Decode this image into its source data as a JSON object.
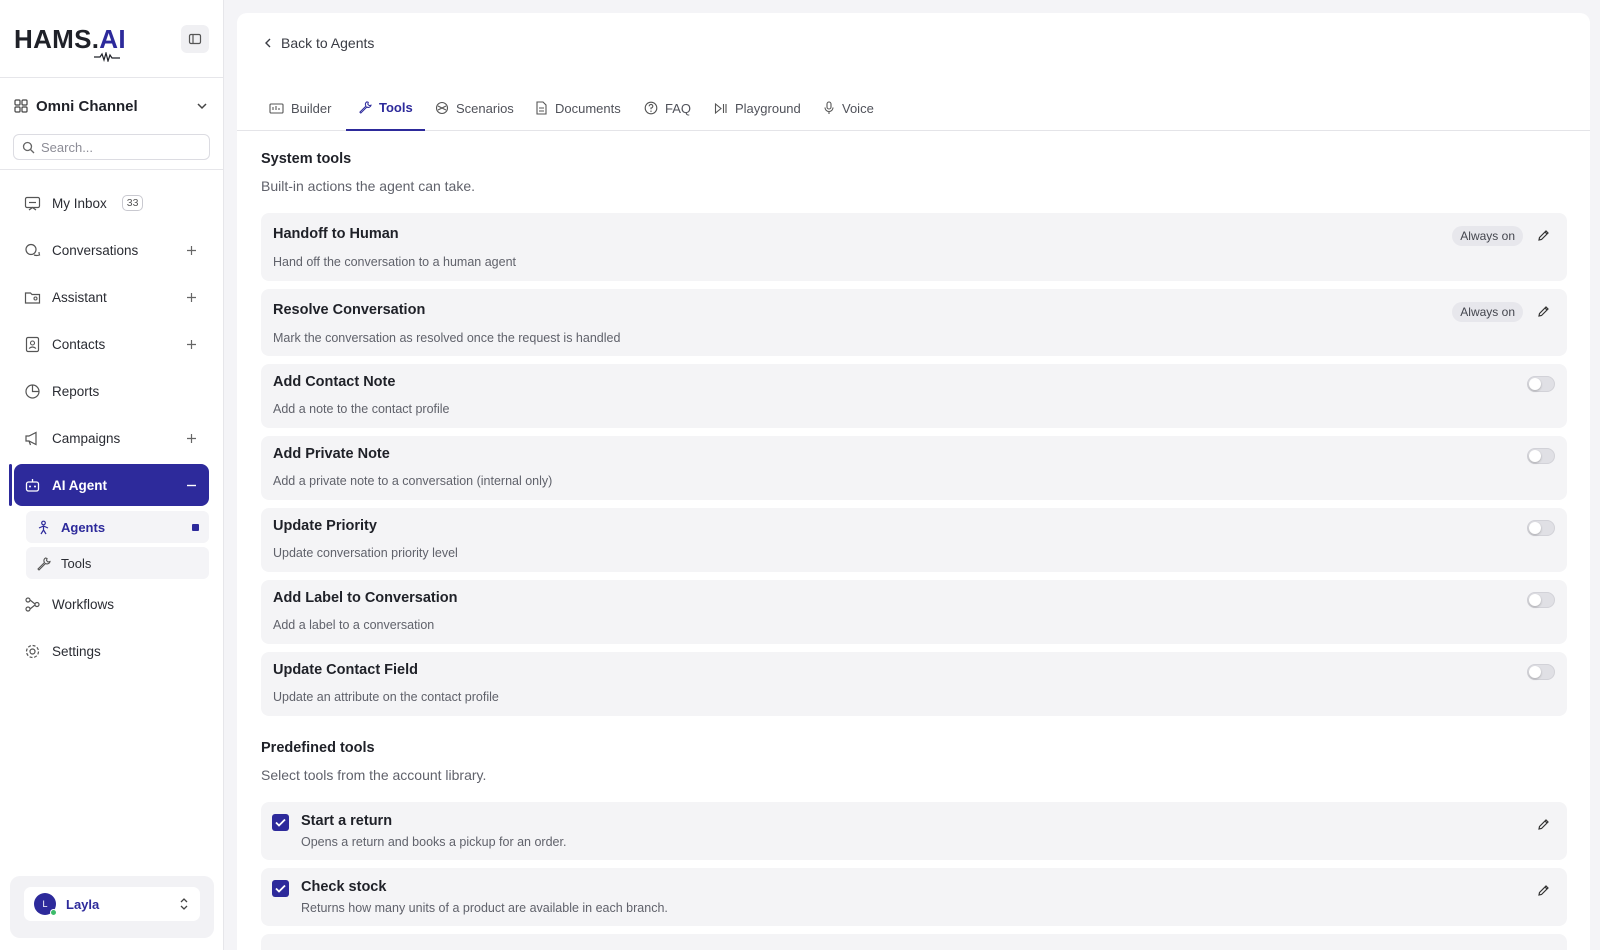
{
  "brand": {
    "logo_main": "HAMS.",
    "logo_ai": "AI",
    "accent": "#2d2a9b"
  },
  "workspace": {
    "name": "Omni Channel"
  },
  "search": {
    "placeholder": "Search..."
  },
  "nav": {
    "inbox": {
      "label": "My Inbox",
      "count": "33"
    },
    "conversations": {
      "label": "Conversations"
    },
    "assistant": {
      "label": "Assistant"
    },
    "contacts": {
      "label": "Contacts"
    },
    "reports": {
      "label": "Reports"
    },
    "campaigns": {
      "label": "Campaigns"
    },
    "ai_agent": {
      "label": "AI Agent"
    },
    "agents": {
      "label": "Agents"
    },
    "tools": {
      "label": "Tools"
    },
    "workflows": {
      "label": "Workflows"
    },
    "settings": {
      "label": "Settings"
    }
  },
  "user": {
    "initial": "L",
    "name": "Layla"
  },
  "main": {
    "back_label": "Back to Agents",
    "tabs": [
      "Builder",
      "Tools",
      "Scenarios",
      "Documents",
      "FAQ",
      "Playground",
      "Voice"
    ],
    "active_tab": "Tools"
  },
  "system_tools": {
    "title": "System tools",
    "subtitle": "Built-in actions the agent can take.",
    "always_on_label": "Always on",
    "items": [
      {
        "name": "Handoff to Human",
        "desc": "Hand off the conversation to a human agent",
        "state": "always_on"
      },
      {
        "name": "Resolve Conversation",
        "desc": "Mark the conversation as resolved once the request is handled",
        "state": "always_on"
      },
      {
        "name": "Add Contact Note",
        "desc": "Add a note to the contact profile",
        "state": "off"
      },
      {
        "name": "Add Private Note",
        "desc": "Add a private note to a conversation (internal only)",
        "state": "off"
      },
      {
        "name": "Update Priority",
        "desc": "Update conversation priority level",
        "state": "off"
      },
      {
        "name": "Add Label to Conversation",
        "desc": "Add a label to a conversation",
        "state": "off"
      },
      {
        "name": "Update Contact Field",
        "desc": "Update an attribute on the contact profile",
        "state": "off"
      }
    ]
  },
  "predefined_tools": {
    "title": "Predefined tools",
    "subtitle": "Select tools from the account library.",
    "items": [
      {
        "name": "Start a return",
        "desc": "Opens a return and books a pickup for an order.",
        "checked": true
      },
      {
        "name": "Check stock",
        "desc": "Returns how many units of a product are available in each branch.",
        "checked": true
      }
    ]
  }
}
